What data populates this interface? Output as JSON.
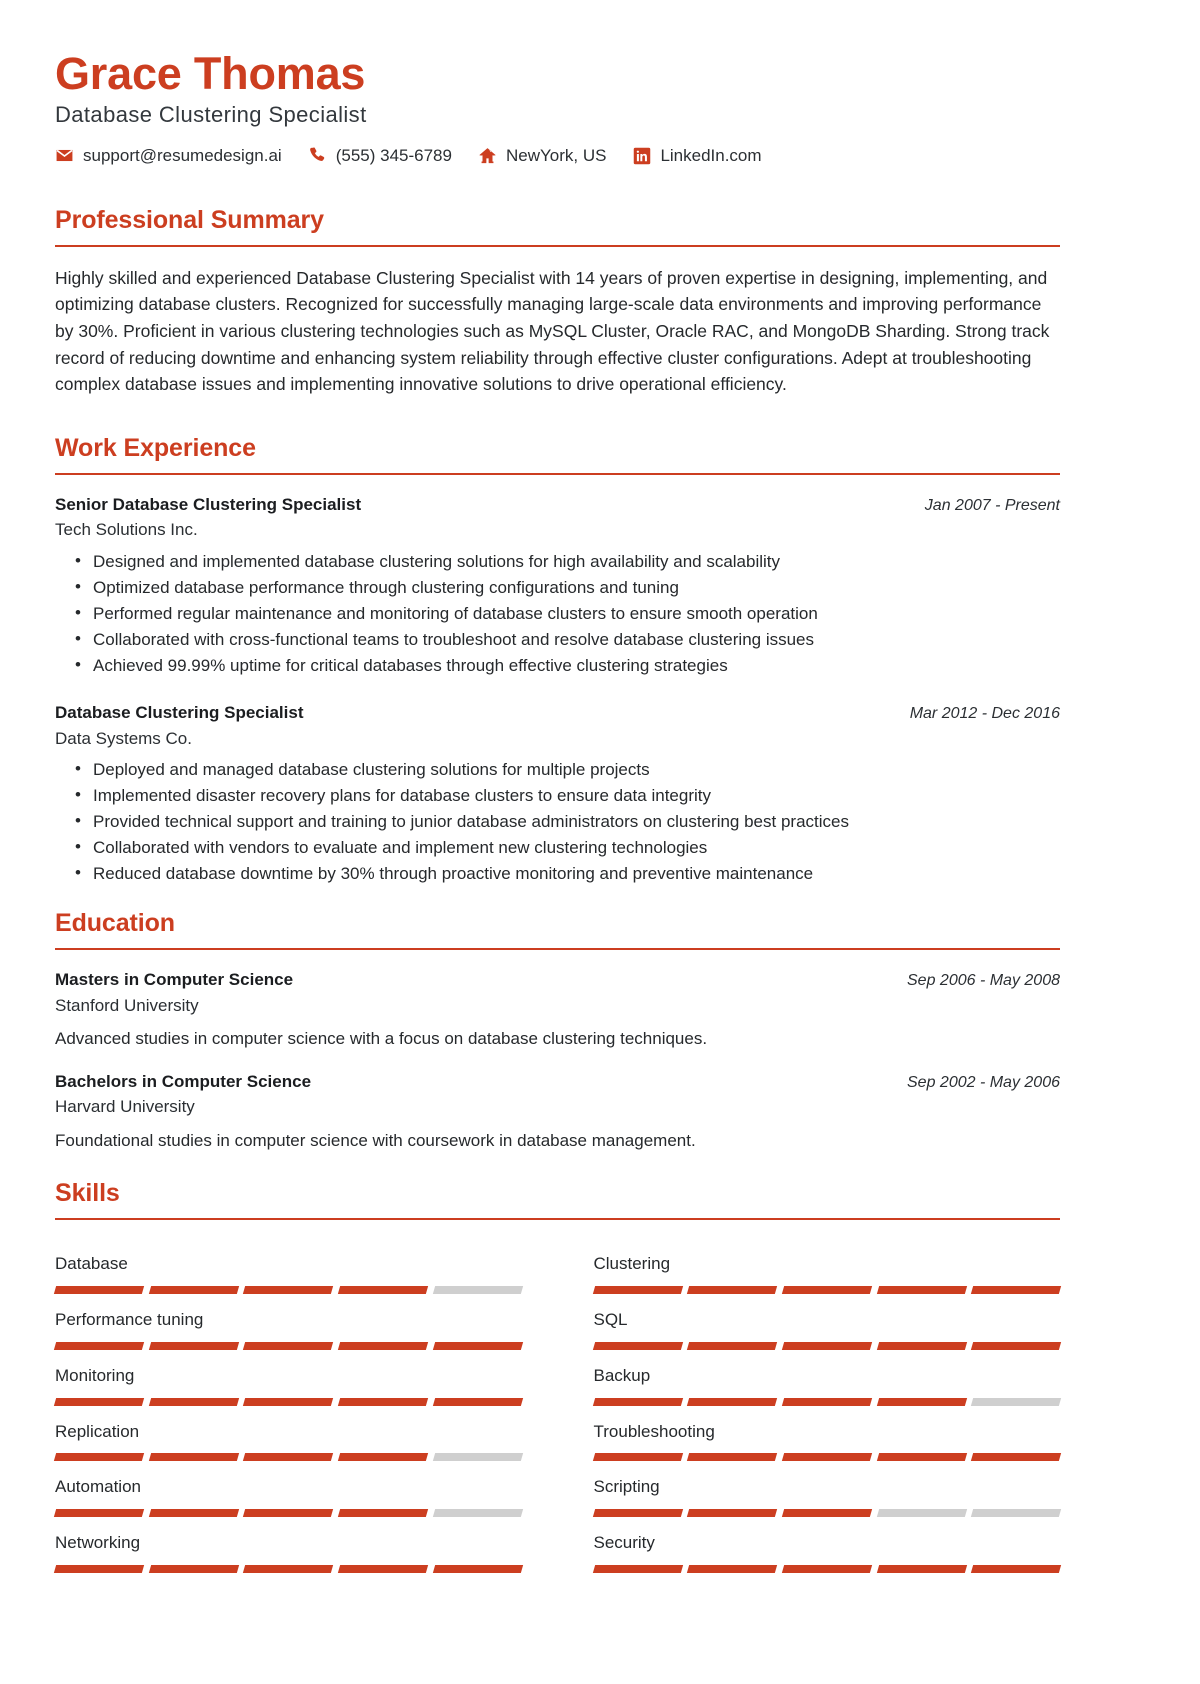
{
  "header": {
    "name": "Grace Thomas",
    "job_title": "Database Clustering Specialist",
    "contacts": [
      {
        "icon": "envelope-icon",
        "text": "support@resumedesign.ai"
      },
      {
        "icon": "phone-icon",
        "text": "(555) 345-6789"
      },
      {
        "icon": "home-icon",
        "text": "NewYork, US"
      },
      {
        "icon": "linkedin-icon",
        "text": "LinkedIn.com"
      }
    ]
  },
  "accent_color": "#cc3e20",
  "summary": {
    "title": "Professional Summary",
    "text": "Highly skilled and experienced Database Clustering Specialist with 14 years of proven expertise in designing, implementing, and optimizing database clusters. Recognized for successfully managing large-scale data environments and improving performance by 30%. Proficient in various clustering technologies such as MySQL Cluster, Oracle RAC, and MongoDB Sharding. Strong track record of reducing downtime and enhancing system reliability through effective cluster configurations. Adept at troubleshooting complex database issues and implementing innovative solutions to drive operational efficiency."
  },
  "work": {
    "title": "Work Experience",
    "entries": [
      {
        "title": "Senior Database Clustering Specialist",
        "org": "Tech Solutions Inc.",
        "date": "Jan 2007 - Present",
        "bullets": [
          "Designed and implemented database clustering solutions for high availability and scalability",
          "Optimized database performance through clustering configurations and tuning",
          "Performed regular maintenance and monitoring of database clusters to ensure smooth operation",
          "Collaborated with cross-functional teams to troubleshoot and resolve database clustering issues",
          "Achieved 99.99% uptime for critical databases through effective clustering strategies"
        ]
      },
      {
        "title": "Database Clustering Specialist",
        "org": "Data Systems Co.",
        "date": "Mar 2012 - Dec 2016",
        "bullets": [
          "Deployed and managed database clustering solutions for multiple projects",
          "Implemented disaster recovery plans for database clusters to ensure data integrity",
          "Provided technical support and training to junior database administrators on clustering best practices",
          "Collaborated with vendors to evaluate and implement new clustering technologies",
          "Reduced database downtime by 30% through proactive monitoring and preventive maintenance"
        ]
      }
    ]
  },
  "education": {
    "title": "Education",
    "entries": [
      {
        "title": "Masters in Computer Science",
        "org": "Stanford University",
        "date": "Sep 2006 - May 2008",
        "desc": "Advanced studies in computer science with a focus on database clustering techniques."
      },
      {
        "title": "Bachelors in Computer Science",
        "org": "Harvard University",
        "date": "Sep 2002 - May 2006",
        "desc": "Foundational studies in computer science with coursework in database management."
      }
    ]
  },
  "skills": {
    "title": "Skills",
    "max_level": 5,
    "items": [
      {
        "name": "Database",
        "level": 4
      },
      {
        "name": "Clustering",
        "level": 5
      },
      {
        "name": "Performance tuning",
        "level": 5
      },
      {
        "name": "SQL",
        "level": 5
      },
      {
        "name": "Monitoring",
        "level": 5
      },
      {
        "name": "Backup",
        "level": 4
      },
      {
        "name": "Replication",
        "level": 4
      },
      {
        "name": "Troubleshooting",
        "level": 5
      },
      {
        "name": "Automation",
        "level": 4
      },
      {
        "name": "Scripting",
        "level": 3
      },
      {
        "name": "Networking",
        "level": 5
      },
      {
        "name": "Security",
        "level": 5
      }
    ]
  }
}
